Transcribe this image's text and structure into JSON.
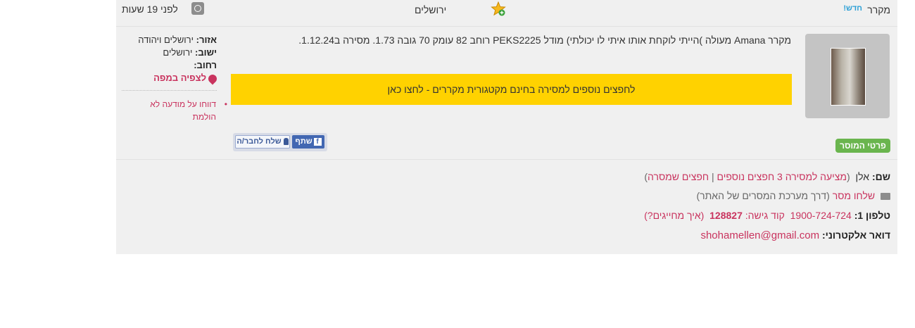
{
  "listing": {
    "category": "מקרר",
    "new_label": "חדש!",
    "city": "ירושלים",
    "time_ago": "לפני 19 שעות",
    "description": "מקרר Amana מעולה )הייתי לוקחת אותו איתי לו יכולתי) מודל PEKS2225 רוחב 82 עומק 70 גובה 1.73. מסירה ב1.12.24."
  },
  "banner": {
    "text": "לחפצים נוספים למסירה בחינם מקטגורית מקררים - לחצו כאן"
  },
  "share": {
    "facebook_label": "שתף",
    "send_friend_label": "שלח לחבר/ה"
  },
  "seller_badge": "פרטי המוסר",
  "location": {
    "region_label": "אזור:",
    "region_value": "ירושלים ויהודה",
    "town_label": "ישוב:",
    "town_value": "ירושלים",
    "street_label": "רחוב:",
    "street_value": "",
    "map_link": "לצפיה במפה"
  },
  "report_link": "דווחו על מודעה לא הולמת",
  "contact": {
    "name_label": "שם:",
    "name_value": "אלן",
    "offers_link": "מציעה למסירה 3 חפצים נוספים",
    "separator": "|",
    "saved_link": "חפצים שמסרה",
    "send_message_link": "שלחו מסר",
    "send_message_note": "(דרך מערכת המסרים של האתר)",
    "phone_label": "טלפון 1:",
    "phone_number": "1900-724-724",
    "access_code_label": "קוד גישה:",
    "access_code": "128827",
    "how_charged_link": "(איך מחייגים?)",
    "email_label": "דואר אלקטרוני:",
    "email_value": "shohamellen@gmail.com"
  },
  "colors": {
    "banner": "#ffd200",
    "accent_pink": "#c9335e",
    "new_blue": "#2a9fd6",
    "seller_green": "#6ab54e",
    "facebook": "#4267b2"
  }
}
